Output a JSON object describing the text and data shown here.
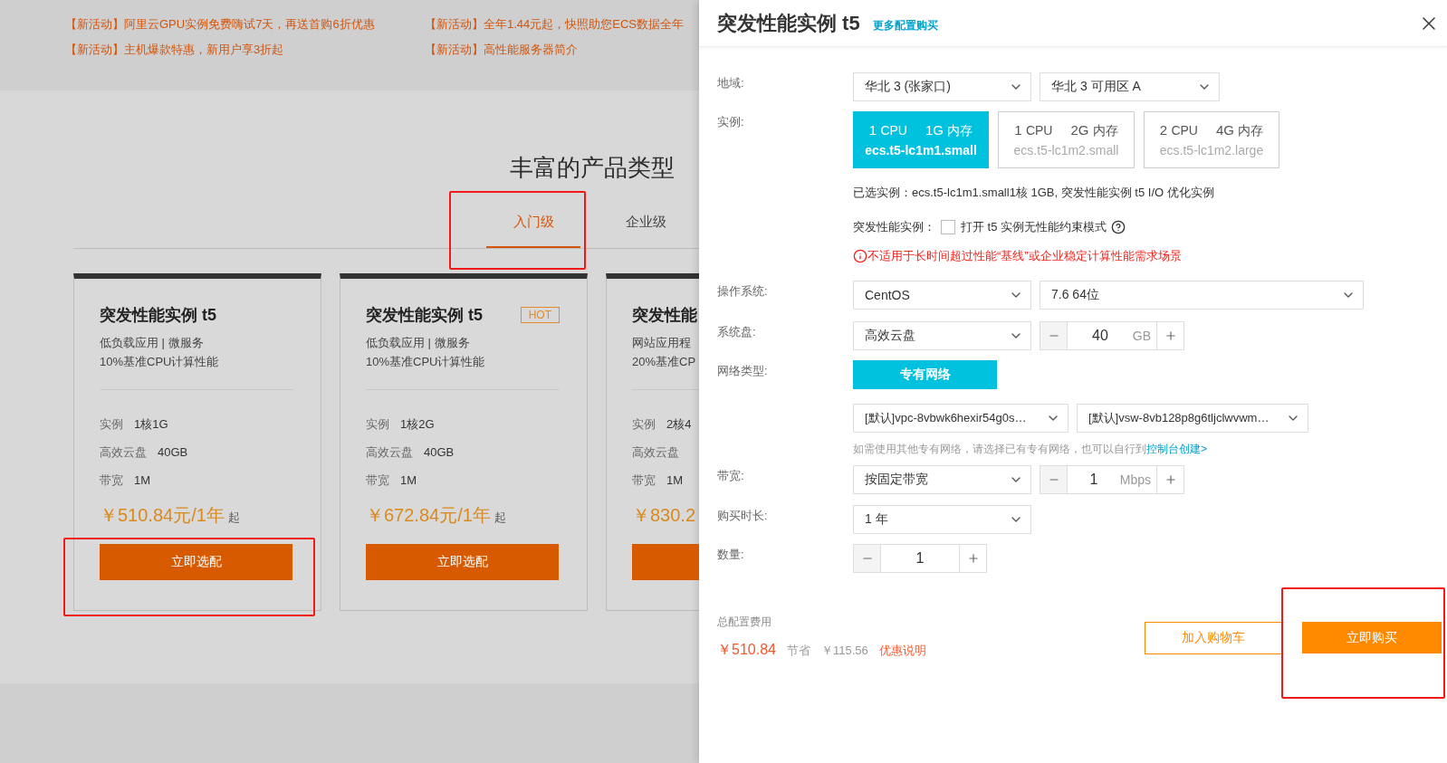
{
  "promotions": [
    {
      "text": "【新活动】阿里云GPU实例免费嗨试7天，再送首购6折优惠"
    },
    {
      "text": "【新活动】全年1.44元起，快照助您ECS数据全年"
    },
    {
      "text": "【新活动】主机爆款特惠，新用户享3折起"
    },
    {
      "text": "【新活动】高性能服务器简介"
    }
  ],
  "section_title": "丰富的产品类型",
  "tabs": [
    {
      "label": "入门级",
      "selected": true,
      "highlighted": true
    },
    {
      "label": "企业级",
      "selected": false,
      "highlighted": false
    }
  ],
  "cards": [
    {
      "title": "突发性能实例 t5",
      "lines": [
        "低负载应用 | 微服务",
        "10%基准CPU计算性能"
      ],
      "specs": [
        {
          "label": "实例",
          "value": "1核1G"
        },
        {
          "label": "高效云盘",
          "value": "40GB"
        },
        {
          "label": "带宽",
          "value": "1M"
        }
      ],
      "price": "￥510.84元/1年",
      "price_suffix": "起",
      "button": {
        "label": "立即选配",
        "highlighted": true
      }
    },
    {
      "title": "突发性能实例 t5",
      "badge": "HOT",
      "lines": [
        "低负载应用 | 微服务",
        "10%基准CPU计算性能"
      ],
      "specs": [
        {
          "label": "实例",
          "value": "1核2G"
        },
        {
          "label": "高效云盘",
          "value": "40GB"
        },
        {
          "label": "带宽",
          "value": "1M"
        }
      ],
      "price": "￥672.84元/1年",
      "price_suffix": "起",
      "button": {
        "label": "立即选配",
        "highlighted": false
      }
    },
    {
      "title": "突发性能",
      "lines": [
        "网站应用程",
        "20%基准CP"
      ],
      "specs": [
        {
          "label": "实例",
          "value": "2核4"
        },
        {
          "label": "高效云盘"
        },
        {
          "label": "带宽",
          "value": "1M"
        }
      ],
      "price": "￥830.2",
      "button": {
        "highlighted": false
      }
    }
  ],
  "drawer": {
    "title": "突发性能实例 t5",
    "link": "更多配置购买",
    "region": {
      "label": "地域:",
      "selects": [
        "华北 3 (张家口)",
        "华北 3 可用区 A"
      ]
    },
    "instance": {
      "label": "实例:",
      "options": [
        {
          "cpu": "1",
          "cpu_unit": "CPU",
          "mem": "1G",
          "mem_unit": "内存",
          "type": "ecs.t5-lc1m1.small",
          "selected": true
        },
        {
          "cpu": "1",
          "cpu_unit": "CPU",
          "mem": "2G",
          "mem_unit": "内存",
          "type": "ecs.t5-lc1m2.small",
          "selected": false
        },
        {
          "cpu": "2",
          "cpu_unit": "CPU",
          "mem": "4G",
          "mem_unit": "内存",
          "type": "ecs.t5-lc1m2.large",
          "selected": false
        }
      ]
    },
    "selected_info": "已选实例：ecs.t5-lc1m1.small1核 1GB, 突发性能实例 t5 I/O 优化实例",
    "unlimited": {
      "label": "突发性能实例：",
      "option": "打开 t5 实例无性能约束模式",
      "checked": false
    },
    "warning": "不适用于长时间超过性能“基线”或企业稳定计算性能需求场景",
    "os": {
      "label": "操作系统:",
      "selects": [
        "CentOS",
        "7.6 64位"
      ]
    },
    "disk": {
      "label": "系统盘:",
      "type": "高效云盘",
      "size": "40",
      "unit": "GB"
    },
    "network": {
      "label": "网络类型:",
      "button": "专有网络",
      "selects": [
        "[默认]vpc-8vbwk6hexir54g0s…",
        "[默认]vsw-8vb128p8g6tljclwvwm…"
      ],
      "hint": "如需使用其他专有网络，请选择已有专有网络，也可以自行到",
      "hint_link": "控制台创建>"
    },
    "bandwidth": {
      "label": "带宽:",
      "type": "按固定带宽",
      "value": "1",
      "unit": "Mbps"
    },
    "duration": {
      "label": "购买时长:",
      "value": "1 年"
    },
    "quantity": {
      "label": "数量:",
      "value": "1"
    },
    "footer": {
      "label": "总配置费用",
      "price": "￥510.84",
      "save_label": "节省",
      "save": "￥115.56",
      "discount_link": "优惠说明",
      "cart": {
        "label": "加入购物车",
        "highlighted": false
      },
      "buy": {
        "label": "立即购买",
        "highlighted": true
      }
    }
  }
}
